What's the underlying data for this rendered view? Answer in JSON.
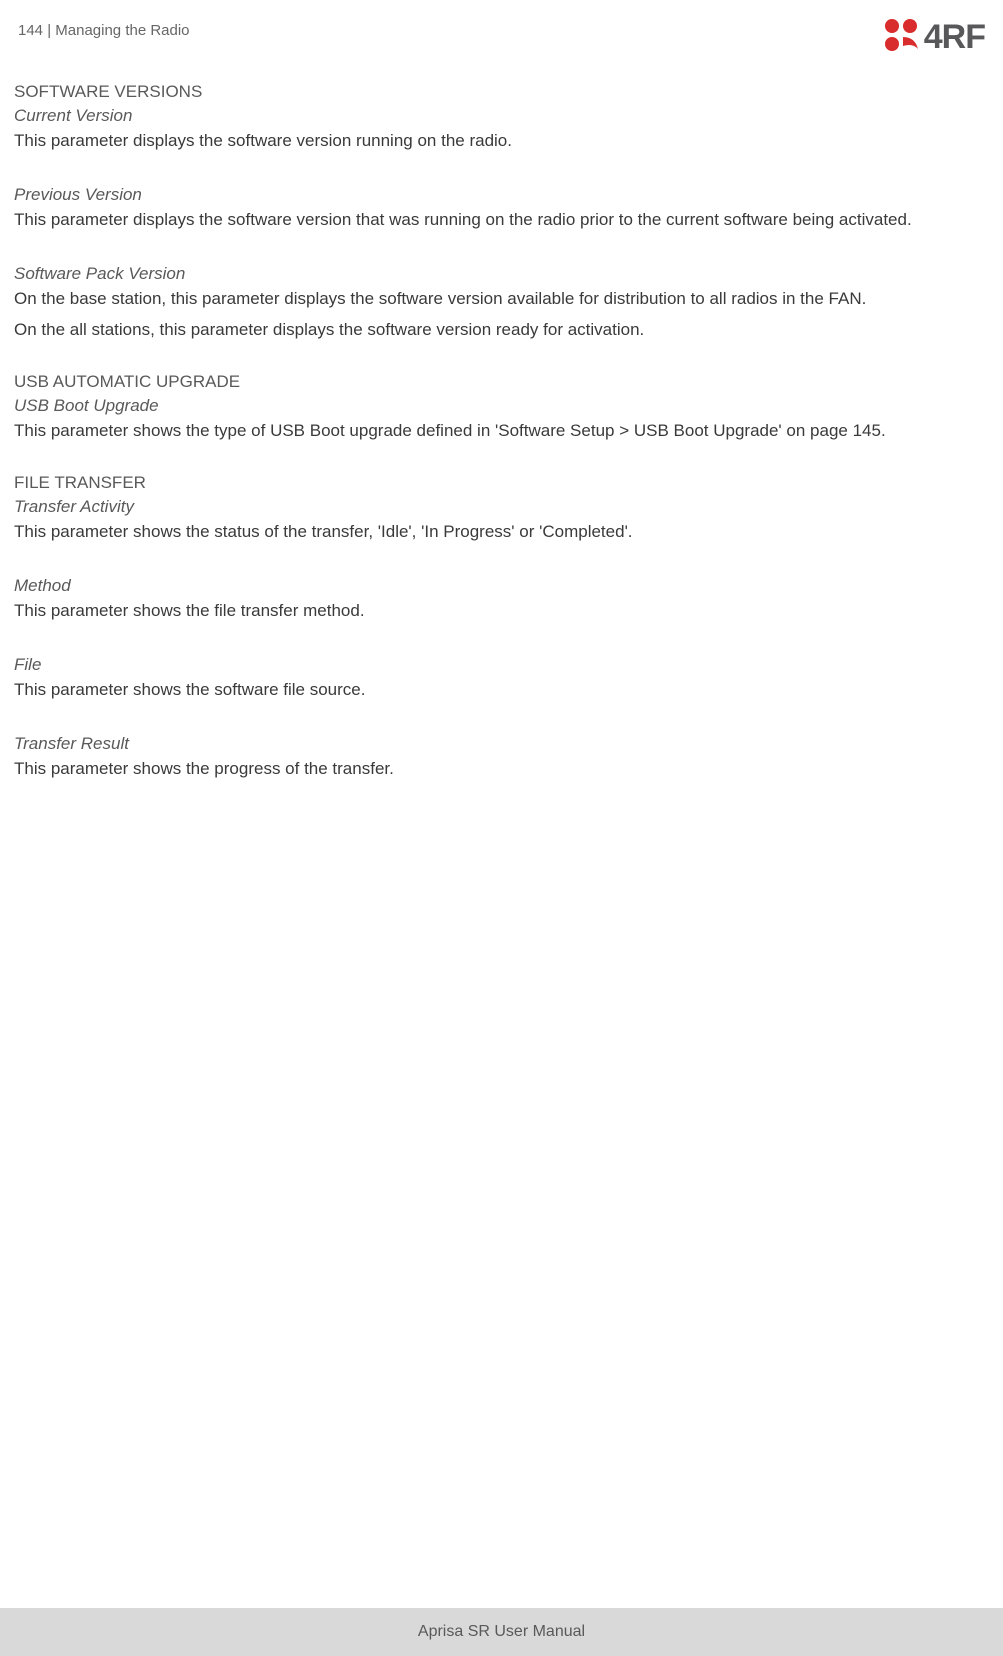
{
  "header": {
    "page_number": "144",
    "separator": "  |  ",
    "section": "Managing the Radio",
    "logo_text": "4RF"
  },
  "sections": {
    "software_versions": {
      "heading": "SOFTWARE VERSIONS",
      "current_version": {
        "heading": "Current Version",
        "text": "This parameter displays the software version running on the radio."
      },
      "previous_version": {
        "heading": "Previous Version",
        "text": "This parameter displays the software version that was running on the radio prior to the current software being activated."
      },
      "software_pack_version": {
        "heading": "Software Pack Version",
        "text1": "On the base station, this parameter displays the software version available for distribution to all radios in the FAN.",
        "text2": "On the all stations, this parameter displays the software version ready for activation."
      }
    },
    "usb_automatic_upgrade": {
      "heading": "USB AUTOMATIC UPGRADE",
      "usb_boot_upgrade": {
        "heading": "USB Boot Upgrade",
        "text": "This parameter shows the type of USB Boot upgrade defined in 'Software Setup > USB Boot Upgrade' on page 145."
      }
    },
    "file_transfer": {
      "heading": "FILE TRANSFER",
      "transfer_activity": {
        "heading": "Transfer Activity",
        "text": "This parameter shows the status of the transfer, 'Idle', 'In Progress' or 'Completed'."
      },
      "method": {
        "heading": "Method",
        "text": "This parameter shows the file transfer method."
      },
      "file": {
        "heading": "File",
        "text": "This parameter shows the software file source."
      },
      "transfer_result": {
        "heading": "Transfer Result",
        "text": "This parameter shows the progress of the transfer."
      }
    }
  },
  "footer": {
    "text": "Aprisa SR User Manual"
  }
}
